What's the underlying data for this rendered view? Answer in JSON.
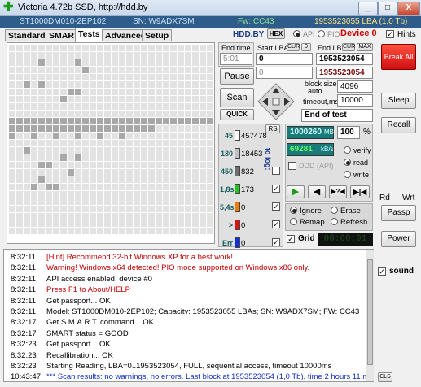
{
  "window": {
    "title": "Victoria 4.72b SSD, http://hdd.by",
    "min": "_",
    "max": "□",
    "close": "X"
  },
  "infobar": {
    "model": "ST1000DM010-2EP102",
    "serial": "SN: W9ADX7SM",
    "fw": "Fw: CC43",
    "size": "1953523055 LBA (1,0 Tb)"
  },
  "tabs": [
    "Standard",
    "SMART",
    "Tests",
    "Advanced",
    "Setup"
  ],
  "brand": "HDD.BY",
  "hex": "HEX",
  "api": "API",
  "pio": "PIO",
  "device": "Device 0",
  "hints": "Hints",
  "grid": {
    "gray_cells": [
      [
        4,
        2
      ],
      [
        9,
        2
      ],
      [
        10,
        3
      ],
      [
        2,
        5
      ],
      [
        4,
        5
      ],
      [
        8,
        6
      ],
      [
        9,
        6
      ],
      [
        7,
        7
      ],
      [
        0,
        10
      ],
      [
        1,
        10
      ],
      [
        2,
        10
      ],
      [
        3,
        10
      ],
      [
        4,
        10
      ],
      [
        5,
        10
      ],
      [
        6,
        10
      ],
      [
        7,
        10
      ],
      [
        8,
        10
      ],
      [
        9,
        10
      ],
      [
        10,
        10
      ],
      [
        11,
        10
      ],
      [
        12,
        10
      ],
      [
        13,
        10
      ],
      [
        14,
        10
      ],
      [
        15,
        10
      ],
      [
        16,
        10
      ],
      [
        17,
        10
      ],
      [
        18,
        10
      ],
      [
        19,
        10
      ],
      [
        20,
        10
      ],
      [
        21,
        10
      ],
      [
        22,
        10
      ],
      [
        23,
        10
      ],
      [
        24,
        10
      ],
      [
        25,
        10
      ],
      [
        26,
        10
      ],
      [
        27,
        10
      ],
      [
        0,
        11
      ],
      [
        1,
        11
      ],
      [
        2,
        11
      ],
      [
        3,
        11
      ],
      [
        4,
        11
      ],
      [
        5,
        11
      ],
      [
        6,
        11
      ],
      [
        7,
        11
      ],
      [
        8,
        11
      ],
      [
        9,
        11
      ],
      [
        10,
        11
      ],
      [
        11,
        11
      ],
      [
        12,
        11
      ],
      [
        13,
        11
      ],
      [
        14,
        11
      ],
      [
        15,
        11
      ],
      [
        16,
        11
      ],
      [
        17,
        11
      ],
      [
        18,
        11
      ],
      [
        19,
        11
      ],
      [
        0,
        12
      ],
      [
        3,
        12
      ],
      [
        6,
        12
      ],
      [
        9,
        12
      ],
      [
        12,
        12
      ],
      [
        15,
        12
      ],
      [
        2,
        14
      ],
      [
        7,
        15
      ],
      [
        9,
        15
      ],
      [
        4,
        16
      ],
      [
        5,
        16
      ],
      [
        8,
        17
      ],
      [
        4,
        18
      ],
      [
        3,
        19
      ],
      [
        5,
        19
      ],
      [
        6,
        19
      ]
    ]
  },
  "test": {
    "end_time_label": "End time",
    "start_lba_label": "Start LBA",
    "cur": "CUR",
    "end_lba_label": "End LBA",
    "max": "MAX",
    "end_time_value": "5:01",
    "start_lba_value": "0",
    "end_lba_value": "1953523054",
    "start_lba_value2": "0",
    "end_lba_value2": "1953523054",
    "pause": "Pause",
    "scan": "Scan",
    "quick": "QUICK",
    "block_size_label": "block size",
    "auto": "auto",
    "block_size": "4096",
    "timeout_label": "timeout,ms",
    "timeout": "10000",
    "end_mode": "End of test",
    "break_all": "Break All",
    "sleep": "Sleep",
    "recall": "Recall"
  },
  "counters": {
    "rs": "RS",
    "to_log": "to log:",
    "rows": [
      {
        "label": "45",
        "value": "457478",
        "color": "#ffffff"
      },
      {
        "label": "180",
        "value": "18453",
        "color": "#c0c0c0"
      },
      {
        "label": "450",
        "value": "832",
        "color": "#6e6e6e"
      },
      {
        "label": "1,8s",
        "value": "173",
        "color": "#22c322"
      },
      {
        "label": "5,4s",
        "value": "0",
        "color": "#f07a00"
      },
      {
        "label": ">",
        "value": "0",
        "color": "#e01010"
      },
      {
        "label": "Err",
        "value": "0",
        "color": "#1030e0"
      }
    ]
  },
  "stats": {
    "mb": "1000260",
    "mb_unit": "MB",
    "percent": "100",
    "pct_unit": "%",
    "speed": "69281",
    "speed_unit": "kB/s",
    "ddd": "DDD (API)",
    "verify": "verify",
    "read": "read",
    "write": "write",
    "ignore": "Ignore",
    "erase": "Erase",
    "remap": "Remap",
    "refresh": "Refresh",
    "grid": "Grid",
    "timer": "00:00:01"
  },
  "side": {
    "rd": "Rd",
    "wrt": "Wrt",
    "passp": "Passp",
    "power": "Power",
    "sound": "sound",
    "cls": "CLS"
  },
  "log": [
    {
      "time": "8:32:11",
      "text": "[Hint] Recommend 32-bit Windows XP for a best work!",
      "color": "#c00000"
    },
    {
      "time": "8:32:11",
      "text": "Warning! Windows x64 detected! PIO mode supported on Windows x86 only.",
      "color": "#c00000"
    },
    {
      "time": "8:32:11",
      "text": "API access enabled, device #0",
      "color": "#000000"
    },
    {
      "time": "8:32:11",
      "text": "Press F1 to About/HELP",
      "color": "#c00000"
    },
    {
      "time": "8:32:11",
      "text": "Get passport... OK",
      "color": "#000000"
    },
    {
      "time": "8:32:11",
      "text": "Model: ST1000DM010-2EP102; Capacity: 1953523055 LBAs; SN: W9ADX7SM; FW: CC43",
      "color": "#000000"
    },
    {
      "time": "8:32:17",
      "text": "Get S.M.A.R.T. command... OK",
      "color": "#000000"
    },
    {
      "time": "8:32:17",
      "text": "SMART status = GOOD",
      "color": "#000000"
    },
    {
      "time": "8:32:23",
      "text": "Get passport... OK",
      "color": "#000000"
    },
    {
      "time": "8:32:23",
      "text": "Recallibration... OK",
      "color": "#000000"
    },
    {
      "time": "8:32:23",
      "text": "Starting Reading, LBA=0..1953523054, FULL, sequential access, timeout 10000ms",
      "color": "#000000"
    },
    {
      "time": "10:43:47",
      "text": "*** Scan results: no warnings, no errors. Last block at 1953523054 (1,0 Tb), time 2 hours 11 mi...",
      "color": "#1030c0"
    }
  ]
}
